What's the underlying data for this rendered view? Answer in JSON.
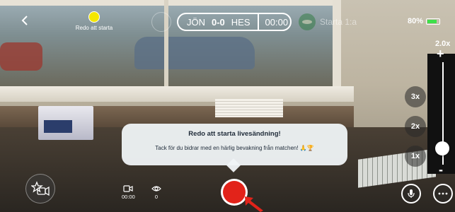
{
  "topbar": {
    "back_icon": "chevron-left-icon",
    "status_label": "Redo att starta",
    "status_color": "#f4e700",
    "score": {
      "home": "JÖN",
      "value": "0-0",
      "away": "HES",
      "clock": "00:00"
    },
    "start_label": "Starta 1:a",
    "battery_percent_label": "80%",
    "battery_level": 0.8,
    "battery_color": "#3ee04a"
  },
  "zoom": {
    "current_label": "2.0x",
    "plus_label": "+",
    "minus_label": "-",
    "presets": [
      "3x",
      "2x",
      "1x"
    ]
  },
  "toast": {
    "title": "Redo att starta livesändning!",
    "message": "Tack för du bidrar med en härlig bevakning från matchen! 🙏🏆"
  },
  "bottombar": {
    "duration": "00:00",
    "viewers": "0",
    "record_color": "#e2231a"
  }
}
